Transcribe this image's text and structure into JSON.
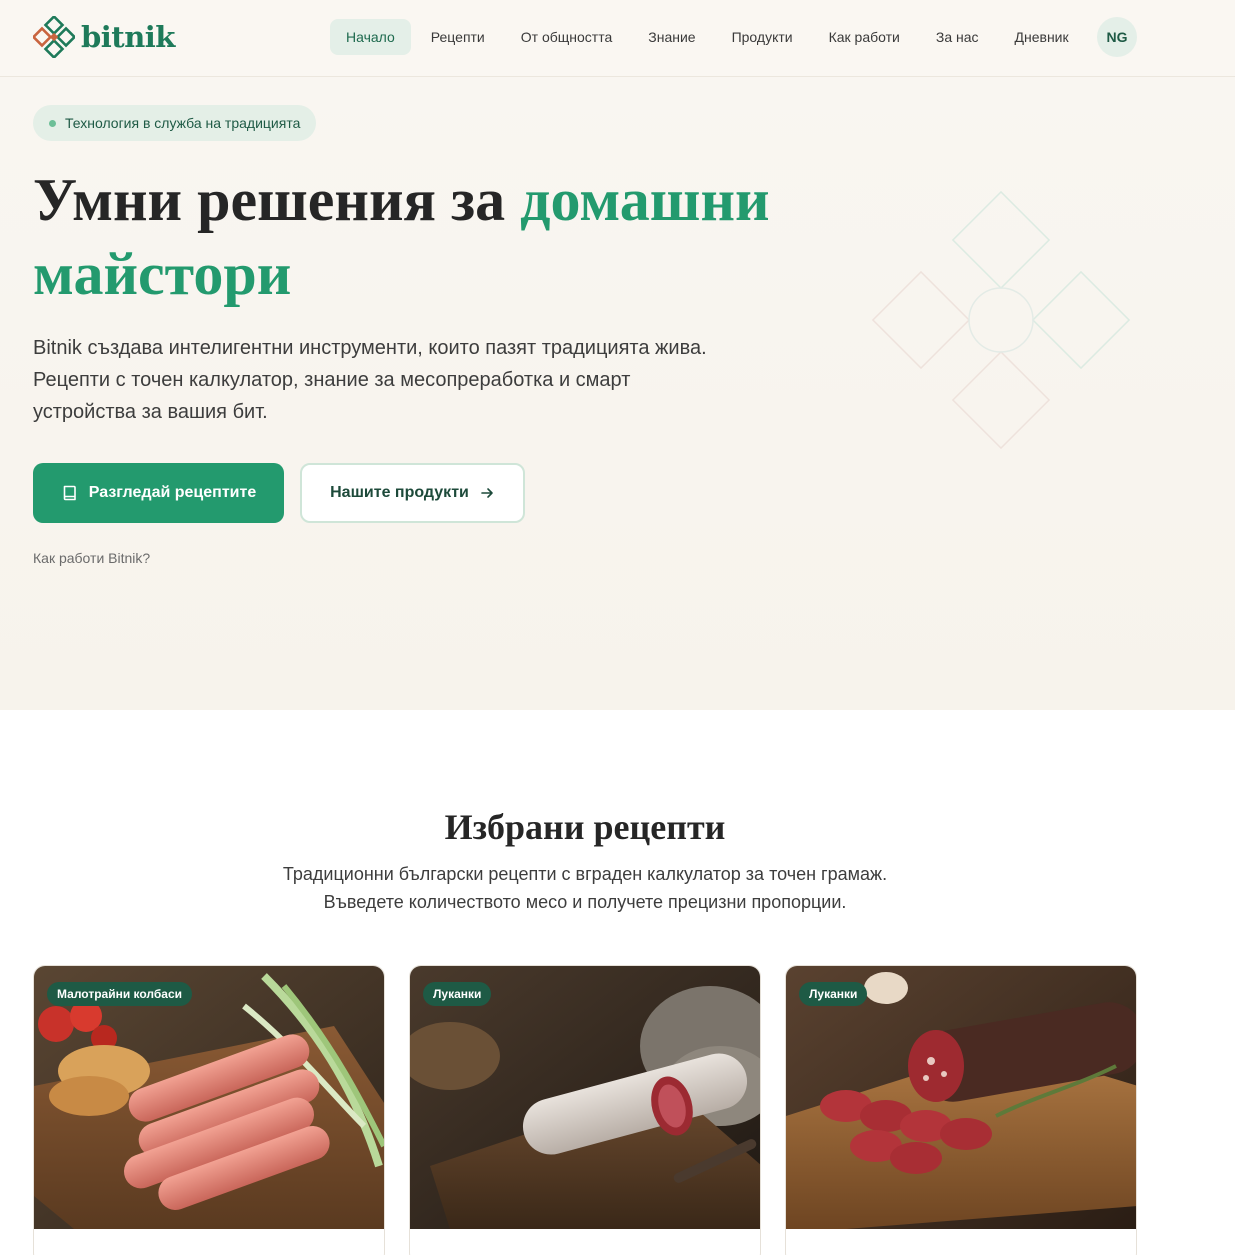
{
  "brand": {
    "name": "bitnik"
  },
  "nav": {
    "items": [
      {
        "label": "Начало",
        "active": true
      },
      {
        "label": "Рецепти"
      },
      {
        "label": "От общността"
      },
      {
        "label": "Знание"
      },
      {
        "label": "Продукти"
      },
      {
        "label": "Как работи"
      },
      {
        "label": "За нас"
      },
      {
        "label": "Дневник"
      }
    ],
    "avatar_initials": "NG"
  },
  "hero": {
    "badge": "Технология в служба на традицията",
    "title_plain": "Умни решения за ",
    "title_accent": "домашни майстори",
    "description": "Bitnik създава интелигентни инструменти, които пазят традицията жива. Рецепти с точен калкулатор, знание за месопреработка и смарт устройства за вашия бит.",
    "primary_button": "Разгледай рецептите",
    "secondary_button": "Нашите продукти",
    "how_link": "Как работи Bitnik?"
  },
  "recipes": {
    "title": "Избрани рецепти",
    "subtitle_line1": "Традиционни български рецепти с вграден калкулатор за точен грамаж.",
    "subtitle_line2": "Въведете количеството месо и получете прецизни пропорции.",
    "cards": [
      {
        "tag": "Малотрайни колбаси",
        "image": "sausages-on-board"
      },
      {
        "tag": "Луканки",
        "image": "dry-salami-on-board"
      },
      {
        "tag": "Луканки",
        "image": "sliced-lukanka-on-board"
      }
    ]
  },
  "colors": {
    "accent": "#239a6e",
    "dark_green": "#1e5a45",
    "hero_bg": "#f9f6f1",
    "badge_bg": "#e4efe7"
  }
}
